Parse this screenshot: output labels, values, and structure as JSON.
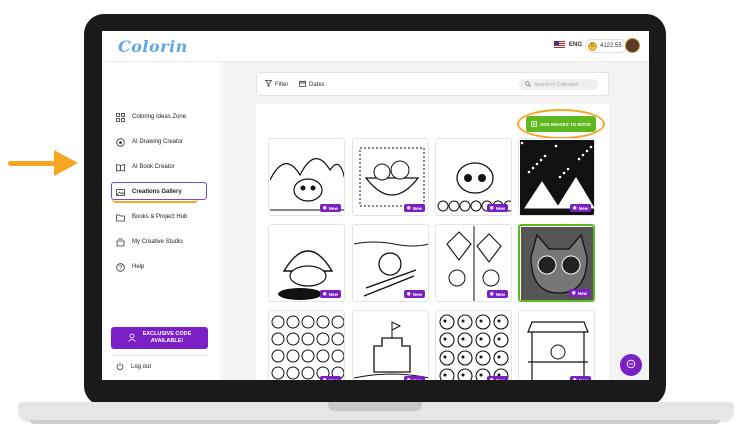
{
  "app": {
    "logo": "Colorin"
  },
  "topbar": {
    "language": "ENG",
    "balance": "4122.55",
    "coin_symbol": "G"
  },
  "sidebar": {
    "items": [
      {
        "label": "Coloring Ideas Zone",
        "icon": "grid-icon"
      },
      {
        "label": "AI Drawing Creator",
        "icon": "brain-icon"
      },
      {
        "label": "AI Book Creator",
        "icon": "book-icon"
      },
      {
        "label": "Creations Gallery",
        "icon": "gallery-icon",
        "active": true
      },
      {
        "label": "Books & Project Hub",
        "icon": "folder-icon"
      },
      {
        "label": "My Creative Studio",
        "icon": "studio-icon"
      },
      {
        "label": "Help",
        "icon": "help-icon"
      }
    ],
    "promo": {
      "line1": "EXCLUSIVE CODE",
      "line2": "AVAILABLE!"
    },
    "logout": "Log out"
  },
  "toolbar": {
    "filter": "Filter",
    "dates": "Dates",
    "search_placeholder": "Search in Collection"
  },
  "gallery": {
    "add_button": "ADD IMAGES TO BOOK",
    "badge": "New",
    "cards": [
      {
        "subject": "owl-forest"
      },
      {
        "subject": "fruit-bowl"
      },
      {
        "subject": "kawaii-bunny-flowers"
      },
      {
        "subject": "night-camping"
      },
      {
        "subject": "shell-creature"
      },
      {
        "subject": "beach-lounger"
      },
      {
        "subject": "kites-kids"
      },
      {
        "subject": "cat-sunglasses",
        "selected": true
      },
      {
        "subject": "flower-creatures"
      },
      {
        "subject": "sandcastle"
      },
      {
        "subject": "bubble-critters"
      },
      {
        "subject": "market-stall"
      }
    ]
  },
  "colors": {
    "accent": "#7a1fc4",
    "green": "#5fb820",
    "annotation": "#f6a623",
    "logo": "#5fa8e8"
  }
}
